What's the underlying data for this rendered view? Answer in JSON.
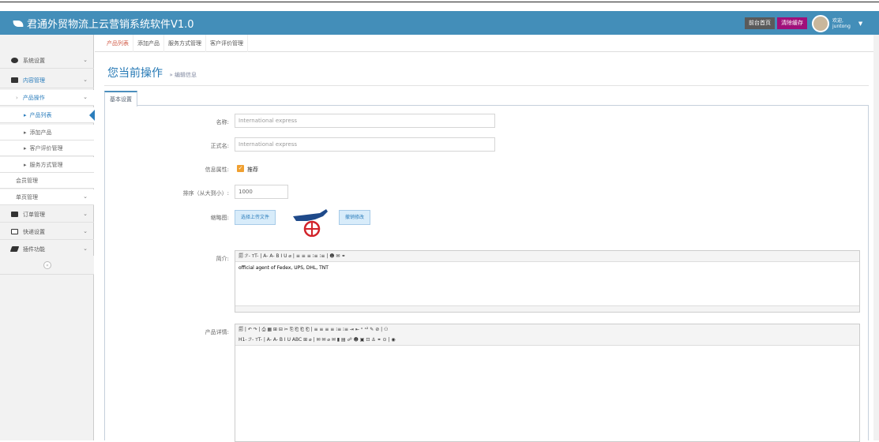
{
  "header": {
    "title": "君通外贸物流上云营销系统软件V1.0",
    "btn_home": "前台首页",
    "btn_clear": "清除缓存",
    "welcome": "欢迎,",
    "username": "juntong"
  },
  "sidebar": {
    "items": [
      {
        "label": "系统设置"
      },
      {
        "label": "内容管理"
      },
      {
        "label": "产品操作"
      },
      {
        "label": "产品列表"
      },
      {
        "label": "添加产品"
      },
      {
        "label": "客户评价管理"
      },
      {
        "label": "服务方式管理"
      },
      {
        "label": "会员管理"
      },
      {
        "label": "单页管理"
      },
      {
        "label": "订单管理"
      },
      {
        "label": "快递设置"
      },
      {
        "label": "插件功能"
      }
    ]
  },
  "tabs": [
    "产品列表",
    "添加产品",
    "服务方式管理",
    "客户评价管理"
  ],
  "page": {
    "title": "您当前操作",
    "crumb": "» 编辑信息",
    "tab": "基本设置"
  },
  "form": {
    "name_label": "名称:",
    "name_value": "International express",
    "fullname_label": "正式名:",
    "fullname_value": "International express",
    "attr_label": "信息属性:",
    "attr_option": "推荐",
    "sort_label": "排序（从大到小）:",
    "sort_value": "1000",
    "thumb_label": "缩略图:",
    "upload_btn": "选择上传文件",
    "undo_btn": "撤销修改",
    "intro_label": "简介:",
    "intro_text": "official agent of Fedex, UPS, DHL, TNT",
    "detail_label": "产品详情:"
  },
  "editor": {
    "toolbar_intro": "🗐 ℱ- тT- | A- A- B I U ⌀ | ≡ ≡ ≡ ⁝≡ ⁝≡ | ☻ ✉ ⚭",
    "toolbar_detail_1": "🗐 | ↶ ↷ | ⎙ ▦ ⊞ ⊟ ✂ ⎘ ⎗ ⎗ ⎗ | ≡ ≡ ≡ ≡ ⁝≡ ⁝≡ ⇥ ⇤ ˣ ˣ² ✎ ⊘ | ⚇",
    "toolbar_detail_2": "H1- ℱ- тT- | A- A- B I U ABC ⊞ ⌀ | ✉ ✉ ⌀ ✉ ▮ ▤ ☍ ☻ ▣ ⊡ ⚓ ⚭ ⊙ | ◉"
  },
  "colors": {
    "header_bg": "#438eb9",
    "accent": "#2b7dbc",
    "active_tab": "#d15b47",
    "clear_btn": "#a0107a"
  }
}
